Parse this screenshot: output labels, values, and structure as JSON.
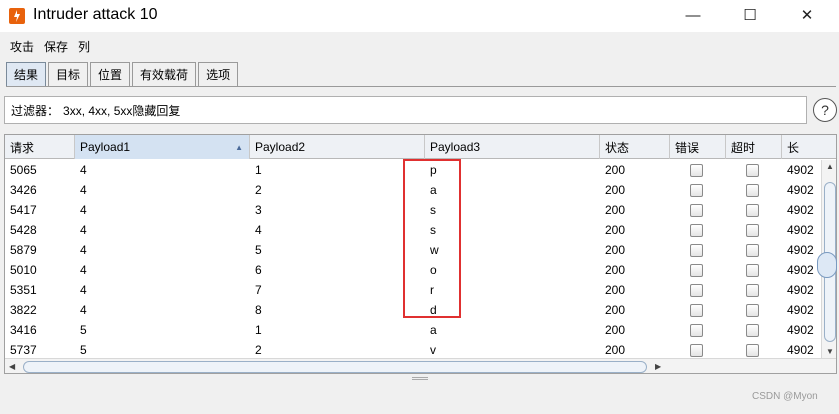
{
  "window": {
    "title": "Intruder attack 10",
    "minimize_label": "—",
    "maximize_label": "☐",
    "close_label": "✕"
  },
  "menu": [
    "攻击",
    "保存",
    "列"
  ],
  "tabs": [
    {
      "label": "结果",
      "active": true
    },
    {
      "label": "目标",
      "active": false
    },
    {
      "label": "位置",
      "active": false
    },
    {
      "label": "有效载荷",
      "active": false
    },
    {
      "label": "选项",
      "active": false
    }
  ],
  "filter": {
    "label": "过滤器：",
    "value": "3xx, 4xx, 5xx隐藏回复",
    "help_label": "?"
  },
  "table": {
    "columns": [
      "请求",
      "Payload1",
      "Payload2",
      "Payload3",
      "状态",
      "错误",
      "超时",
      "长"
    ],
    "sorted_column": "Payload1",
    "rows": [
      {
        "request": "5065",
        "p1": "4",
        "p2": "1",
        "p3": "p",
        "status": "200",
        "error": false,
        "timeout": false,
        "length": "4902"
      },
      {
        "request": "3426",
        "p1": "4",
        "p2": "2",
        "p3": "a",
        "status": "200",
        "error": false,
        "timeout": false,
        "length": "4902"
      },
      {
        "request": "5417",
        "p1": "4",
        "p2": "3",
        "p3": "s",
        "status": "200",
        "error": false,
        "timeout": false,
        "length": "4902"
      },
      {
        "request": "5428",
        "p1": "4",
        "p2": "4",
        "p3": "s",
        "status": "200",
        "error": false,
        "timeout": false,
        "length": "4902"
      },
      {
        "request": "5879",
        "p1": "4",
        "p2": "5",
        "p3": "w",
        "status": "200",
        "error": false,
        "timeout": false,
        "length": "4902"
      },
      {
        "request": "5010",
        "p1": "4",
        "p2": "6",
        "p3": "o",
        "status": "200",
        "error": false,
        "timeout": false,
        "length": "4902"
      },
      {
        "request": "5351",
        "p1": "4",
        "p2": "7",
        "p3": "r",
        "status": "200",
        "error": false,
        "timeout": false,
        "length": "4902"
      },
      {
        "request": "3822",
        "p1": "4",
        "p2": "8",
        "p3": "d",
        "status": "200",
        "error": false,
        "timeout": false,
        "length": "4902"
      },
      {
        "request": "3416",
        "p1": "5",
        "p2": "1",
        "p3": "a",
        "status": "200",
        "error": false,
        "timeout": false,
        "length": "4902"
      },
      {
        "request": "5737",
        "p1": "5",
        "p2": "2",
        "p3": "v",
        "status": "200",
        "error": false,
        "timeout": false,
        "length": "4902"
      }
    ]
  },
  "watermark": "CSDN @Myon⁠",
  "colors": {
    "highlight": "#e03030",
    "active_tab": "#dfe8f3",
    "sorted_header": "#d4e2f2"
  }
}
